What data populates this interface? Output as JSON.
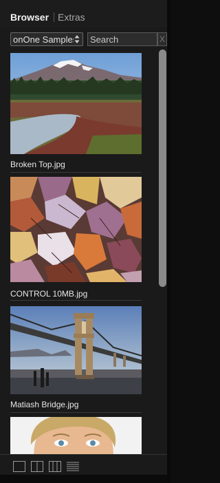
{
  "tabs": {
    "browser": "Browser",
    "extras": "Extras"
  },
  "toolbar": {
    "source_value": "onOne Samples",
    "search_placeholder": "Search",
    "clear_label": "X"
  },
  "files": [
    {
      "name": "Broken Top.jpg"
    },
    {
      "name": "CONTROL 10MB.jpg"
    },
    {
      "name": "Matiash Bridge.jpg"
    },
    {
      "name": ""
    }
  ],
  "view_modes": [
    "single-column-view",
    "two-column-view",
    "three-column-view",
    "list-view"
  ],
  "colors": {
    "panel_bg": "#1a1a1a",
    "text": "#e8e8e8",
    "scroll_thumb": "#8a8a8a"
  }
}
